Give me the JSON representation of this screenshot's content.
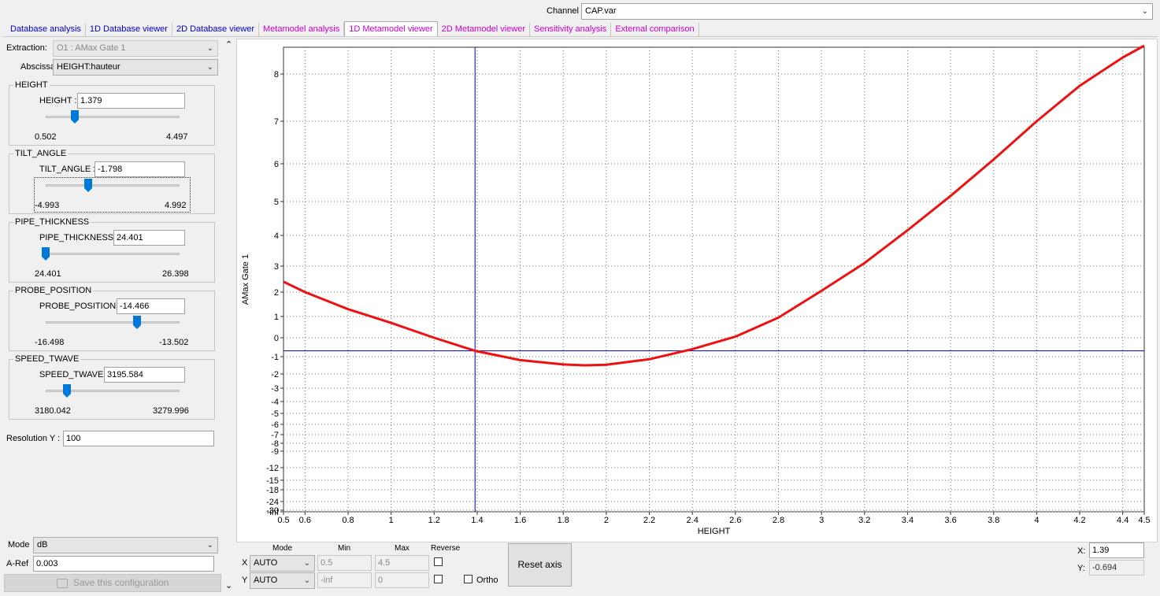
{
  "channel": {
    "label": "Channel",
    "value": "CAP.var"
  },
  "tabs": [
    {
      "label": "Database analysis",
      "color": "#0000cc"
    },
    {
      "label": "1D Database viewer",
      "color": "#0000cc"
    },
    {
      "label": "2D Database viewer",
      "color": "#0000cc"
    },
    {
      "label": "Metamodel analysis",
      "color": "#cc00cc"
    },
    {
      "label": "1D Metamodel viewer",
      "color": "#cc00cc",
      "active": true
    },
    {
      "label": "2D Metamodel viewer",
      "color": "#cc00cc"
    },
    {
      "label": "Sensitivity analysis",
      "color": "#cc00cc"
    },
    {
      "label": "External comparison",
      "color": "#cc00cc"
    }
  ],
  "left": {
    "extraction_label": "Extraction:",
    "extraction_value": "O1 : AMax Gate 1",
    "abscissa_label": "Abscissa",
    "abscissa_value": "HEIGHT:hauteur",
    "params": [
      {
        "title": "HEIGHT",
        "label": "HEIGHT :",
        "value": "1.379",
        "min": "0.502",
        "max": "4.497",
        "fraction": 0.22
      },
      {
        "title": "TILT_ANGLE",
        "label": "TILT_ANGLE :",
        "value": "-1.798",
        "min": "-4.993",
        "max": "4.992",
        "fraction": 0.32
      },
      {
        "title": "PIPE_THICKNESS",
        "label": "PIPE_THICKNESS :",
        "value": "24.401",
        "min": "24.401",
        "max": "26.398",
        "fraction": 0.0
      },
      {
        "title": "PROBE_POSITION",
        "label": "PROBE_POSITION :",
        "value": "-14.466",
        "min": "-16.498",
        "max": "-13.502",
        "fraction": 0.68
      },
      {
        "title": "SPEED_TWAVE",
        "label": "SPEED_TWAVE :",
        "value": "3195.584",
        "min": "3180.042",
        "max": "3279.996",
        "fraction": 0.16
      }
    ],
    "resolution_label": "Resolution Y :",
    "resolution_value": "100",
    "mode_label": "Mode",
    "mode_value": "dB",
    "aref_label": "A-Ref",
    "aref_value": "0.003",
    "save_label": "Save this configuration"
  },
  "axes_controls": {
    "col_mode": "Mode",
    "col_min": "Min",
    "col_max": "Max",
    "col_reverse": "Reverse",
    "x_label": "X",
    "x_mode": "AUTO",
    "x_min": "0.5",
    "x_max": "4.5",
    "y_label": "Y",
    "y_mode": "AUTO",
    "y_min": "-inf",
    "y_max": "0",
    "ortho_label": "Ortho",
    "reset_label": "Reset axis"
  },
  "cursor": {
    "x_label": "X:",
    "x_value": "1.39",
    "y_label": "Y:",
    "y_value": "-0.694"
  },
  "chart_data": {
    "type": "line",
    "xlabel": "HEIGHT",
    "ylabel": "AMax Gate 1",
    "xlim": [
      0.5,
      4.5
    ],
    "x_ticks": [
      "0.5",
      "0.6",
      "0.8",
      "1",
      "1.2",
      "1.4",
      "1.6",
      "1.8",
      "2",
      "2.2",
      "2.4",
      "2.6",
      "2.8",
      "3",
      "3.2",
      "3.4",
      "3.6",
      "3.8",
      "4",
      "4.2",
      "4.4",
      "4.5"
    ],
    "y_ticks": [
      "8",
      "7",
      "6",
      "5",
      "4",
      "3",
      "2",
      "1",
      "0",
      "-1",
      "-2",
      "-3",
      "-4",
      "-5",
      "-6",
      "-7",
      "-8",
      "-9",
      "-12",
      "-15",
      "-18",
      "-24",
      "-30",
      "-inf"
    ],
    "series": [
      {
        "color": "#ee1111",
        "x": [
          0.5,
          0.6,
          0.8,
          1.0,
          1.2,
          1.39,
          1.6,
          1.8,
          1.9,
          2.0,
          2.2,
          2.4,
          2.6,
          2.8,
          3.0,
          3.2,
          3.4,
          3.6,
          3.8,
          4.0,
          4.2,
          4.4,
          4.5
        ],
        "y": [
          2.4,
          2.0,
          1.3,
          0.7,
          0.0,
          -0.69,
          -1.2,
          -1.45,
          -1.5,
          -1.47,
          -1.15,
          -0.6,
          0.05,
          0.95,
          2.05,
          3.1,
          4.15,
          5.15,
          6.1,
          7.0,
          7.75,
          8.35,
          8.6
        ]
      }
    ],
    "crosshair": {
      "x": 1.39,
      "y": -0.694,
      "color": "#0000aa"
    }
  }
}
